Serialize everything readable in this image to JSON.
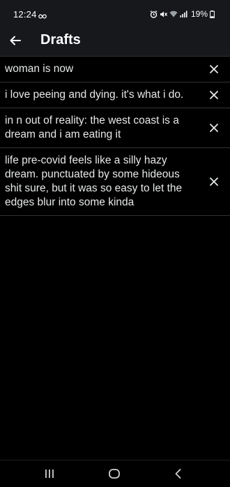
{
  "status_bar": {
    "time": "12:24",
    "battery_percent": "19%",
    "icons": [
      "link-icon",
      "alarm-icon",
      "mute-icon",
      "wifi-icon",
      "signal-icon",
      "battery-icon"
    ]
  },
  "app_bar": {
    "back_icon": "arrow-left-icon",
    "title": "Drafts"
  },
  "drafts": [
    {
      "text": "woman is now"
    },
    {
      "text": "i love peeing and dying. it's what i do."
    },
    {
      "text": "in n out of reality: the west coast is a dream and i am eating it"
    },
    {
      "text": "life pre-covid feels like a silly hazy dream. punctuated by some hideous shit sure, but it was so easy to let the edges blur into some kinda"
    }
  ],
  "nav_bar": {
    "buttons": [
      "recent-apps-icon",
      "home-icon",
      "back-icon"
    ]
  },
  "colors": {
    "background": "#000000",
    "bar_background": "#16181c",
    "divider": "#2f3336",
    "text": "#e7e9ea",
    "icon": "#e7e9ea"
  }
}
